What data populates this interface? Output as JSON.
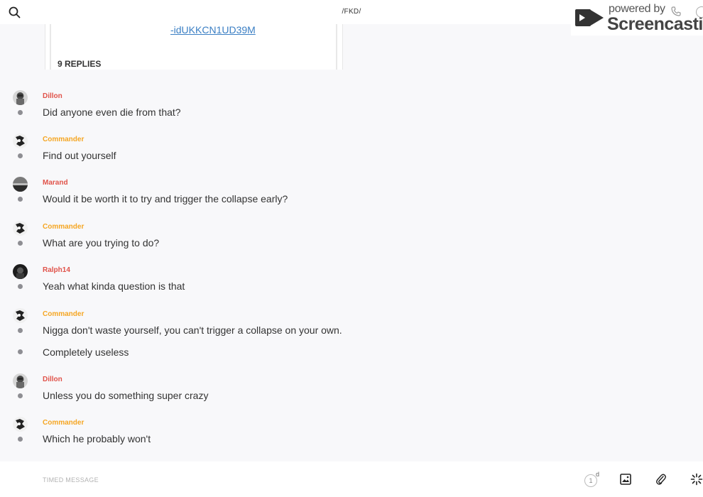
{
  "header": {
    "channel_title": "/FKD/",
    "search_icon": "search-icon",
    "phone_icon": "phone-icon",
    "info_icon": "info-icon"
  },
  "watermark": {
    "powered_by": "powered by",
    "brand": "Screencastify"
  },
  "quoted": {
    "link_text": "-idUKKCN1UD39M",
    "replies_label": "9 REPLIES"
  },
  "messages": [
    {
      "author": "Dillon",
      "author_color": "#e0534a",
      "text": "Did anyone even die from that?",
      "avatar": "avatar-dillon"
    },
    {
      "author": "Commander",
      "author_color": "#f5a623",
      "text": "Find out yourself",
      "avatar": "avatar-commander"
    },
    {
      "author": "Marand",
      "author_color": "#e0534a",
      "text": "Would it be worth it to try and trigger the collapse early?",
      "avatar": "avatar-marand"
    },
    {
      "author": "Commander",
      "author_color": "#f5a623",
      "text": "What are you trying to do?",
      "avatar": "avatar-commander"
    },
    {
      "author": "Ralph14",
      "author_color": "#e0534a",
      "text": "Yeah what kinda question is that",
      "avatar": "avatar-ralph14"
    },
    {
      "author": "Commander",
      "author_color": "#f5a623",
      "text": "Nigga don't waste yourself, you can't trigger a collapse on your own.",
      "avatar": "avatar-commander"
    },
    {
      "author": "",
      "author_color": "#f5a623",
      "text": "Completely useless",
      "avatar": ""
    },
    {
      "author": "Dillon",
      "author_color": "#e0534a",
      "text": "Unless you do something super crazy",
      "avatar": "avatar-dillon"
    },
    {
      "author": "Commander",
      "author_color": "#f5a623",
      "text": "Which he probably won't",
      "avatar": "avatar-commander"
    }
  ],
  "composer": {
    "placeholder": "TIMED MESSAGE",
    "timer_value": "1",
    "timer_unit": "d",
    "image_icon": "image-icon",
    "attach_icon": "paperclip-icon",
    "sparkle_icon": "sparkle-icon"
  },
  "colors": {
    "link": "#3b7fc4",
    "author_red": "#e0534a",
    "author_orange": "#f5a623",
    "status_dot": "#8e8e93"
  }
}
